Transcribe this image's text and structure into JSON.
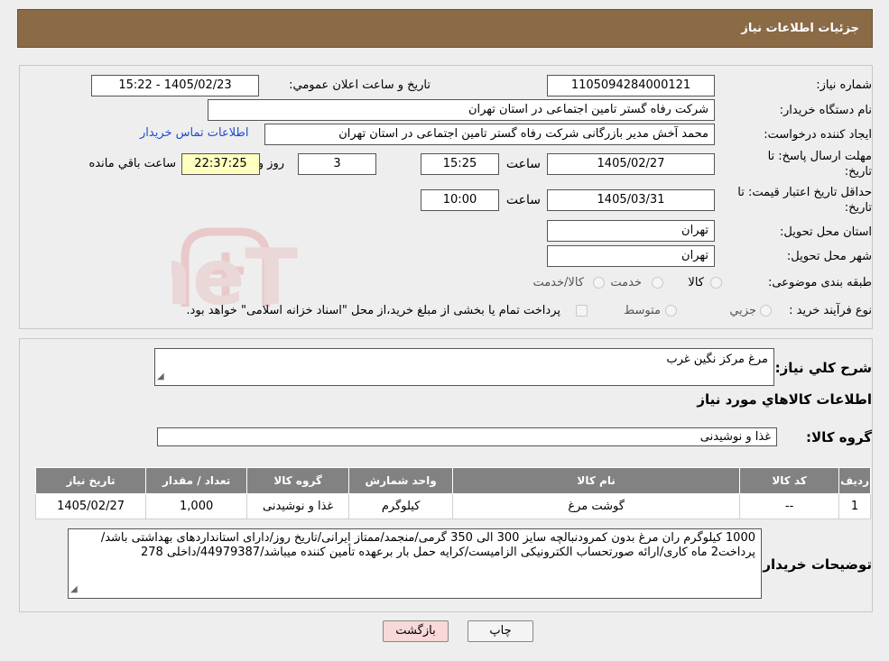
{
  "header": {
    "title": "جزئیات اطلاعات نیاز"
  },
  "need_number": {
    "label": "شماره نیاز:",
    "value": "1105094284000121"
  },
  "announce": {
    "label": "تاریخ و ساعت اعلان عمومي:",
    "value": "1405/02/23 - 15:22"
  },
  "buyer_org": {
    "label": "نام دستگاه خريدار:",
    "value": "شرکت رفاه گستر تامین اجتماعی در استان تهران"
  },
  "requester": {
    "label": "ايجاد کننده درخواست:",
    "value": "محمد آخش مدیر بازرگانی شرکت رفاه گستر تامین اجتماعی در استان تهران",
    "contact_link": "اطلاعات تماس خريدار"
  },
  "reply_deadline": {
    "label_line1": "مهلت ارسال پاسخ: تا",
    "label_line2": "تاريخ:",
    "date": "1405/02/27",
    "time_label": "ساعت",
    "time": "15:25",
    "days": "3",
    "days_label": "روز و",
    "remaining": "22:37:25",
    "remaining_label": "ساعت باقي مانده"
  },
  "price_validity": {
    "label_line1": "حداقل تاريخ اعتبار قيمت: تا",
    "label_line2": "تاريخ:",
    "date": "1405/03/31",
    "time_label": "ساعت",
    "time": "10:00"
  },
  "delivery_province": {
    "label": "استان محل تحويل:",
    "value": "تهران"
  },
  "delivery_city": {
    "label": "شهر محل تحويل:",
    "value": "تهران"
  },
  "category": {
    "label": "طبقه بندی موضوعی:",
    "options": [
      "کالا",
      "خدمت",
      "کالا/خدمت"
    ]
  },
  "purchase_type": {
    "label": "نوع فرآيند خريد :",
    "options": [
      "جزيي",
      "متوسط"
    ],
    "note": "پرداخت تمام يا بخشی از مبلغ خريد،از محل \"اسناد خزانه اسلامی\" خواهد بود."
  },
  "description": {
    "label": "شرح کلي نياز:",
    "value": "مرغ مرکز نگین غرب"
  },
  "goods_section": {
    "title": "اطلاعات کالاهاي مورد نياز"
  },
  "goods_group": {
    "label": "گروه کالا:",
    "value": "غذا و نوشیدنی"
  },
  "table": {
    "headers": [
      "رديف",
      "کد کالا",
      "نام کالا",
      "واحد شمارش",
      "گروه کالا",
      "تعداد / مقدار",
      "تاريخ نياز"
    ],
    "rows": [
      [
        "1",
        "--",
        "گوشت مرغ",
        "کیلوگرم",
        "غذا و نوشیدنی",
        "1,000",
        "1405/02/27"
      ]
    ]
  },
  "buyer_notes": {
    "label": "توضيحات خريدار:",
    "value": "1000 کیلوگرم ران مرغ بدون کمرودنبالچه سایز 300 الی 350 گرمی/منجمد/ممتاز ایرانی/تاریخ روز/دارای استانداردهای بهداشتی باشد/پرداخت2 ماه کاری/ارائه صورتحساب الکترونیکی الزامیست/کرایه حمل بار برعهده تأمین کننده میباشد/44979387/داخلی 278"
  },
  "buttons": {
    "print": "چاپ",
    "back": "بازگشت"
  },
  "colors": {
    "header_bg": "#8b6a46",
    "table_header_bg": "#828282",
    "back_button_bg": "#f8d8d8",
    "remaining_bg": "#ffffc0",
    "link": "#1a4ecf"
  }
}
